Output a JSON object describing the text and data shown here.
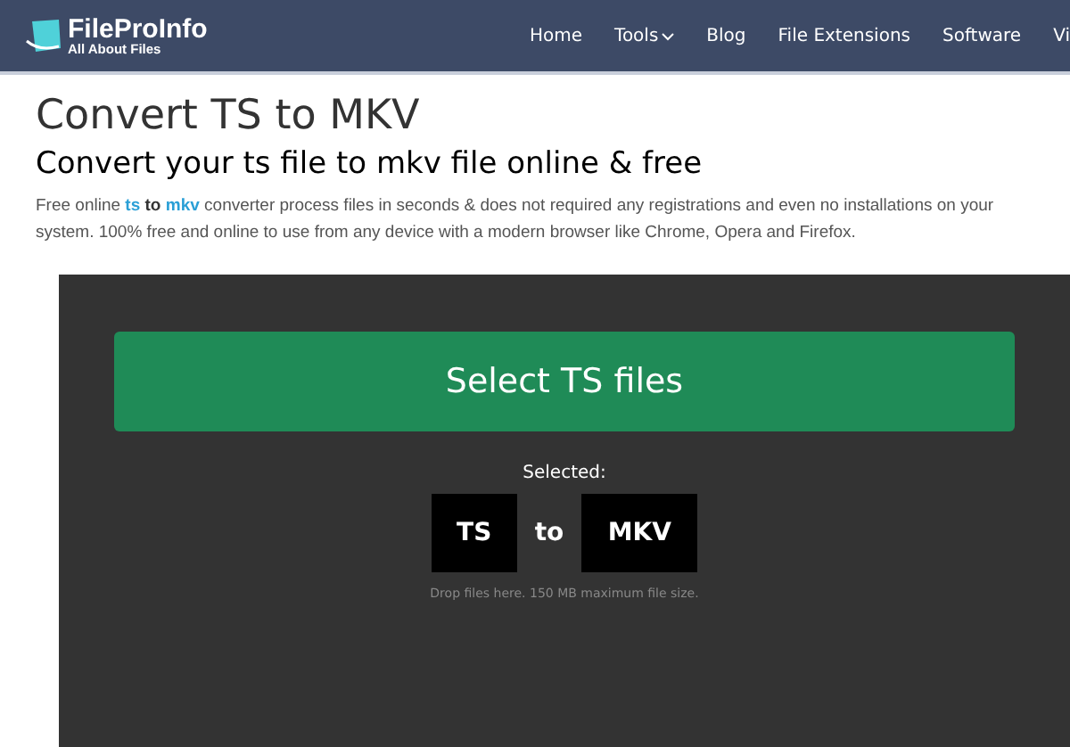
{
  "header": {
    "logo": {
      "name": "FileProInfo",
      "tagline": "All About Files"
    },
    "nav": [
      {
        "label": "Home",
        "has_menu": false
      },
      {
        "label": "Tools",
        "has_menu": true
      },
      {
        "label": "Blog",
        "has_menu": false
      },
      {
        "label": "File Extensions",
        "has_menu": false
      },
      {
        "label": "Software",
        "has_menu": false
      },
      {
        "label": "Vi",
        "has_menu": false
      }
    ]
  },
  "page": {
    "title": "Convert TS to MKV",
    "subtitle": "Convert your ts file to mkv file online & free",
    "description": {
      "before": "Free online",
      "link_1": "ts",
      "middle": "to",
      "link_2": "mkv",
      "after": "converter process files in seconds & does not required any registrations and even no installations on your system. 100% free and online to use from any device with a modern browser like Chrome, Opera and Firefox."
    }
  },
  "converter": {
    "button": "Select TS files",
    "selected_label": "Selected:",
    "from": "TS",
    "joiner": "to",
    "to": "MKV",
    "hint": "Drop files here. 150 MB maximum file size."
  }
}
